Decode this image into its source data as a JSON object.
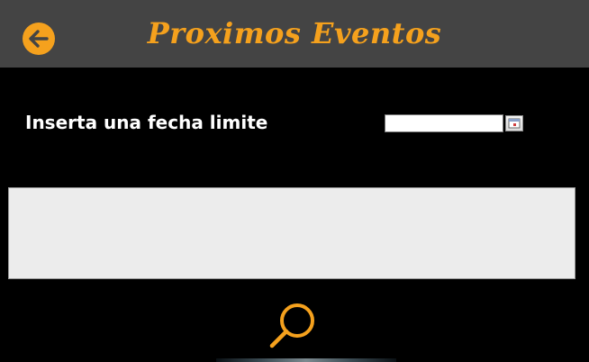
{
  "header": {
    "title": "Proximos Eventos",
    "back_icon": "arrow-left-circle-icon",
    "accent_color": "#F5A11D",
    "bar_color": "#444444"
  },
  "filter": {
    "label": "Inserta una fecha limite",
    "date_value": "",
    "calendar_icon": "calendar-icon"
  },
  "results": {
    "items": []
  },
  "actions": {
    "search_icon": "search-icon"
  }
}
